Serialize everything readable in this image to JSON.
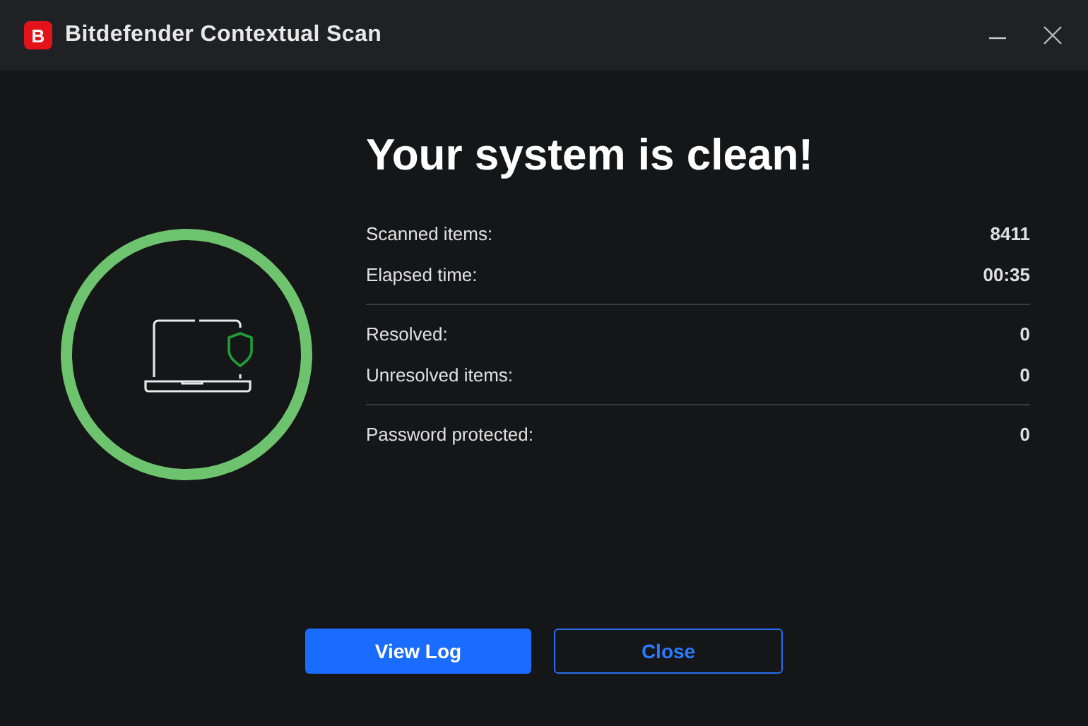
{
  "window": {
    "logo_letter": "B",
    "title": "Bitdefender Contextual Scan"
  },
  "heading": "Your system is clean!",
  "stat_groups": [
    [
      {
        "label": "Scanned items:",
        "value": "8411"
      },
      {
        "label": "Elapsed time:",
        "value": "00:35"
      }
    ],
    [
      {
        "label": "Resolved:",
        "value": "0"
      },
      {
        "label": "Unresolved items:",
        "value": "0"
      }
    ],
    [
      {
        "label": "Password protected:",
        "value": "0"
      }
    ]
  ],
  "buttons": [
    {
      "label": "View Log",
      "kind": "primary"
    },
    {
      "label": "Close",
      "kind": "outline"
    }
  ]
}
